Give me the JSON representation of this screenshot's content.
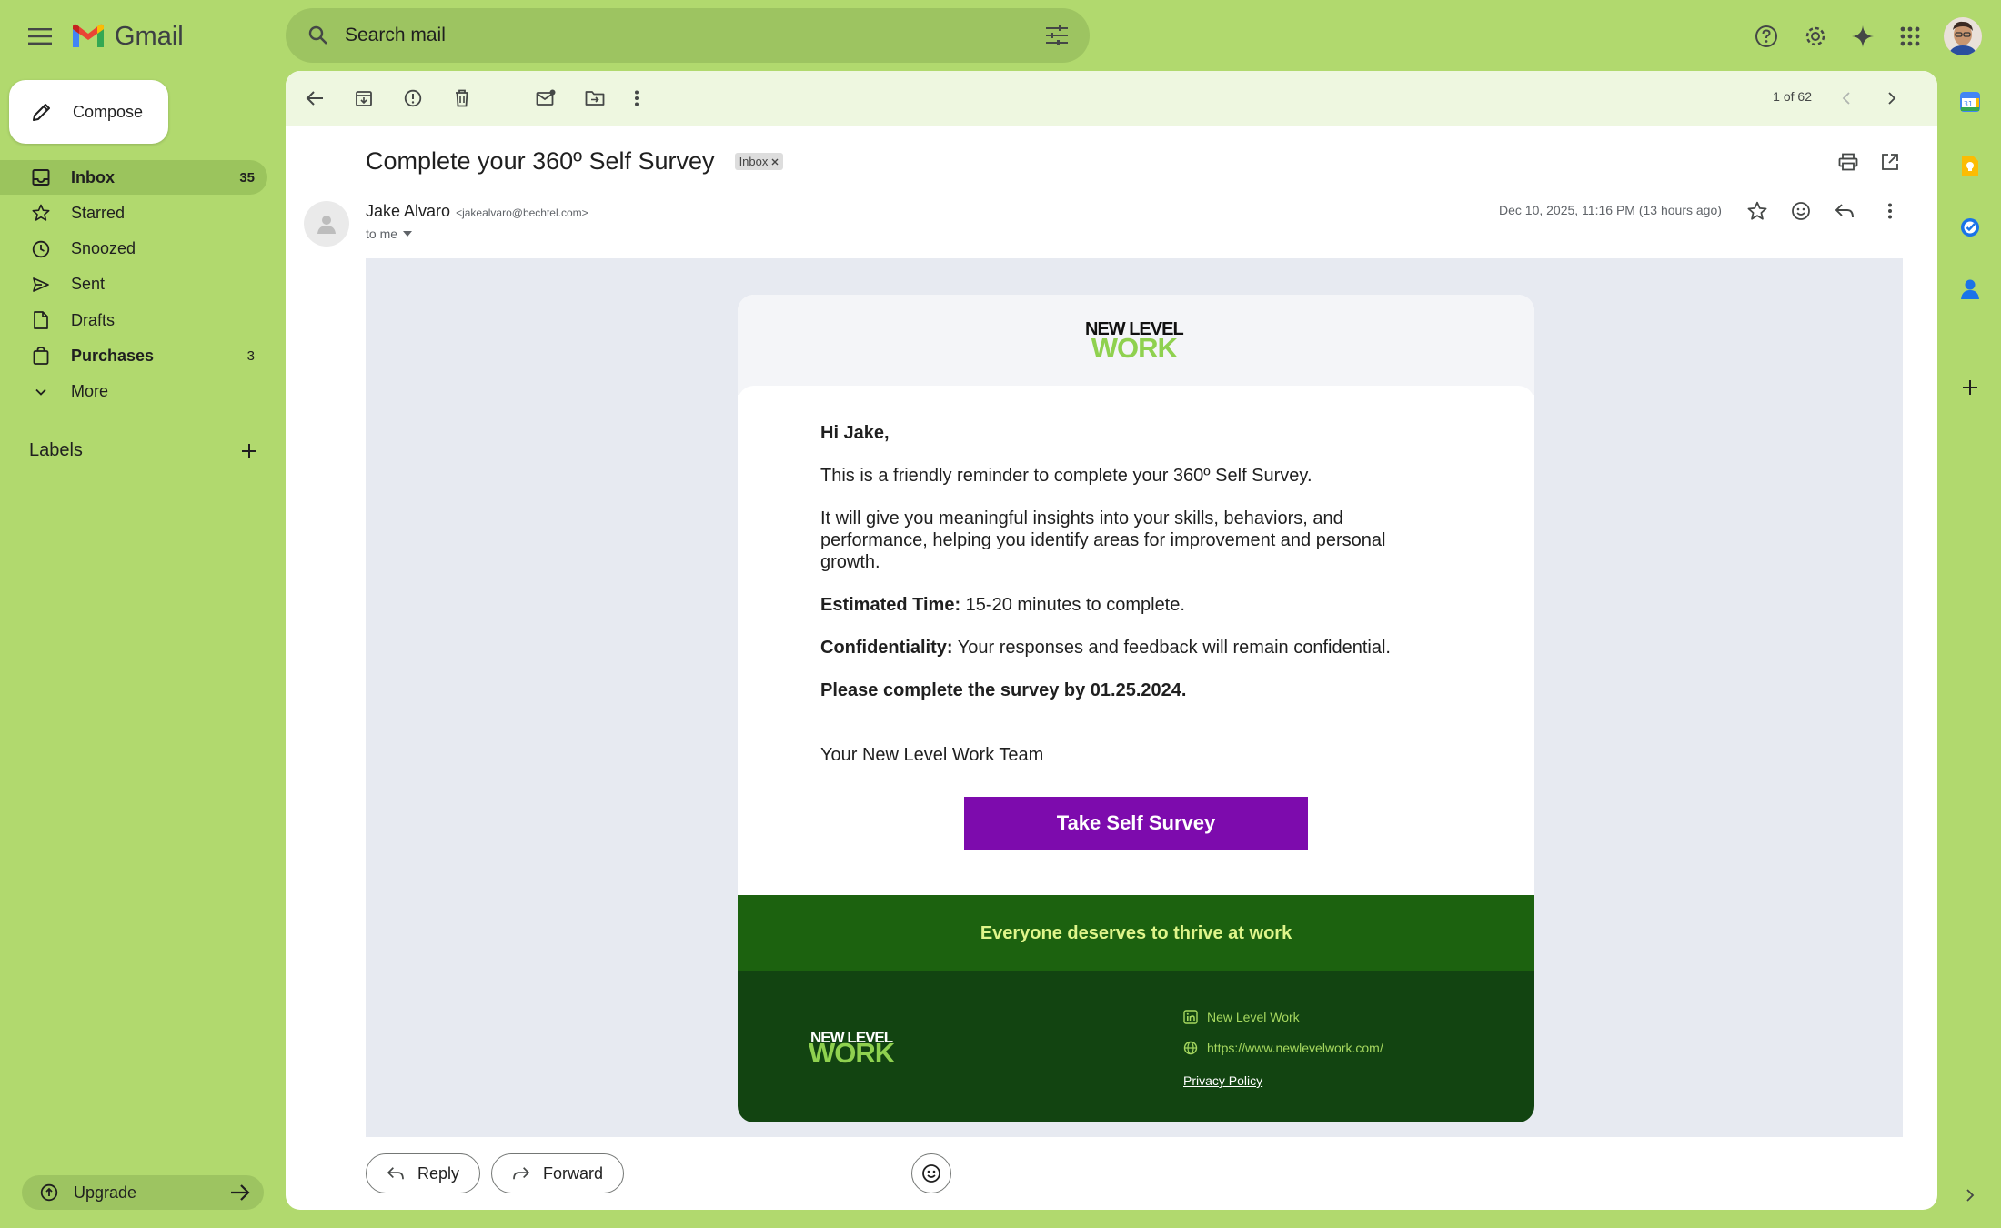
{
  "app": {
    "name": "Gmail"
  },
  "search": {
    "placeholder": "Search mail"
  },
  "compose": {
    "label": "Compose"
  },
  "nav": [
    {
      "label": "Inbox",
      "count": "35"
    },
    {
      "label": "Starred",
      "count": ""
    },
    {
      "label": "Snoozed",
      "count": ""
    },
    {
      "label": "Sent",
      "count": ""
    },
    {
      "label": "Drafts",
      "count": ""
    },
    {
      "label": "Purchases",
      "count": "3"
    },
    {
      "label": "More",
      "count": ""
    }
  ],
  "labels": {
    "title": "Labels"
  },
  "upgrade": {
    "label": "Upgrade"
  },
  "toolbar": {
    "pager": "1 of 62"
  },
  "email": {
    "subject": "Complete your 360º Self Survey",
    "chip": "Inbox",
    "sender_name": "Jake Alvaro",
    "sender_email": "<jakealvaro@bechtel.com>",
    "to": "to me",
    "date": "Dec 10, 2025, 11:16 PM (13 hours ago)",
    "brand_line1": "NEW LEVEL",
    "brand_line2": "WORK",
    "greeting": "Hi Jake,",
    "p1": "This is a friendly reminder to complete your 360º Self Survey.",
    "p2": "It will give you meaningful insights into your skills, behaviors, and performance, helping you identify areas for improvement and personal growth.",
    "est_label": "Estimated Time:",
    "est_value": " 15-20 minutes to complete.",
    "conf_label": "Confidentiality:",
    "conf_value": " Your responses and feedback will remain confidential.",
    "deadline": "Please complete the survey by 01.25.2024.",
    "signoff": "Your New Level Work Team",
    "cta": "Take Self Survey",
    "tagline": "Everyone deserves to thrive at work",
    "footer_company": "New Level Work",
    "footer_url": "https://www.newlevelwork.com/",
    "footer_privacy": "Privacy Policy"
  },
  "actions": {
    "reply": "Reply",
    "forward": "Forward"
  },
  "colors": {
    "background": "#b1d96e",
    "cta": "#7d0bad",
    "tagline_bg": "#1c620f",
    "footer_bg": "#124411",
    "brand_green": "#8fd14f"
  }
}
